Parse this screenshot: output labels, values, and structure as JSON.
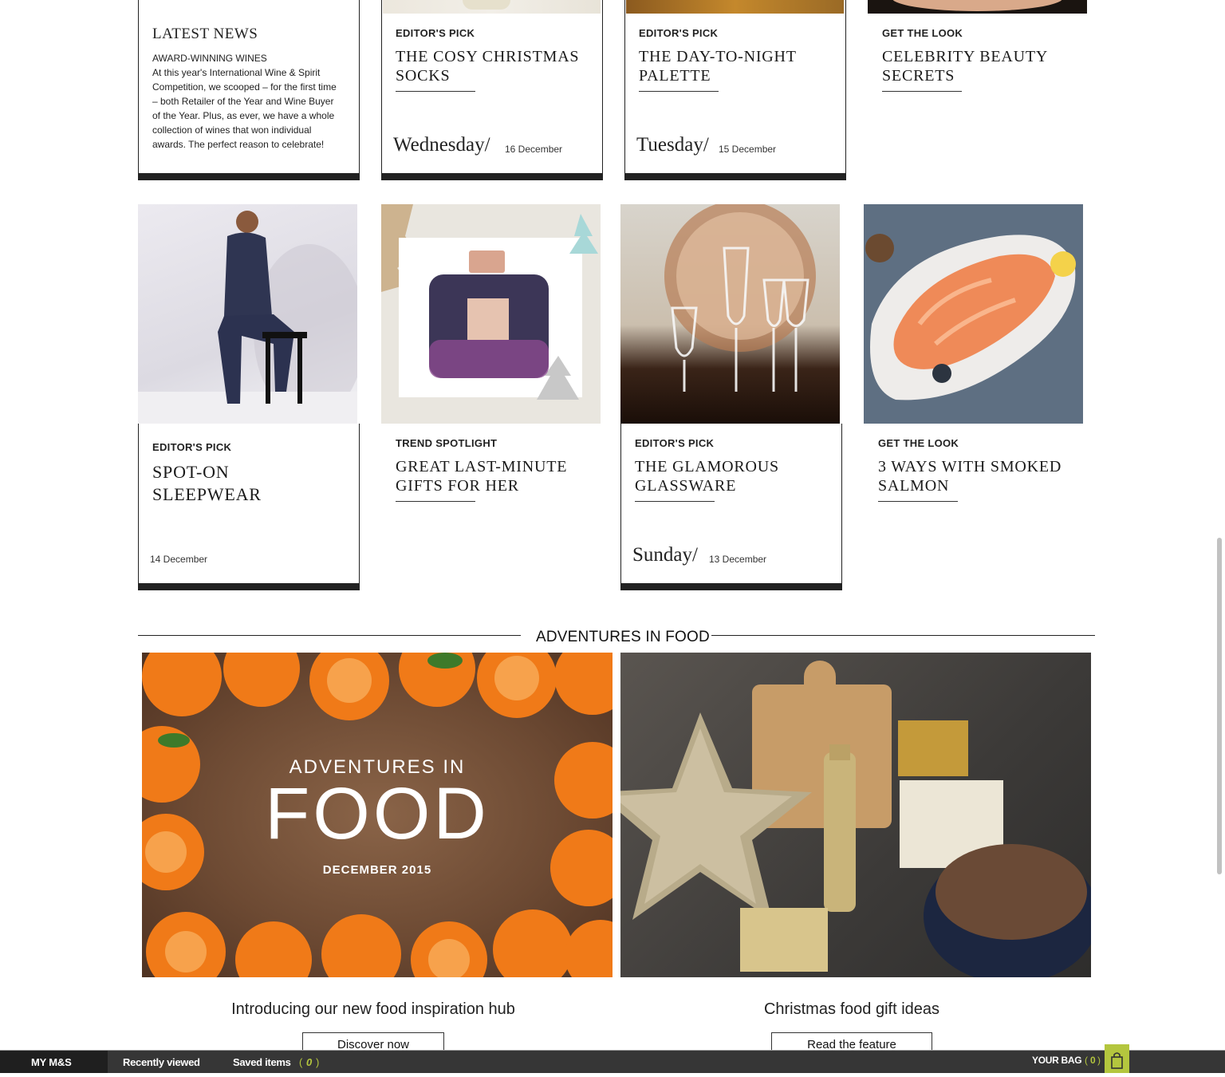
{
  "latest_news": {
    "title": "LATEST NEWS",
    "subtitle": "AWARD-WINNING WINES",
    "body": "At this year's International Wine & Spirit Competition, we scooped – for the first time – both Retailer of the Year and Wine Buyer of the Year. Plus, as ever, we have a whole collection of wines that won individual awards. The perfect reason to celebrate!"
  },
  "row1": [
    {
      "kicker": "EDITOR'S PICK",
      "title": "THE COSY CHRISTMAS SOCKS",
      "day": "Wednesday/",
      "date": "16 December"
    },
    {
      "kicker": "EDITOR'S PICK",
      "title": "THE DAY-TO-NIGHT PALETTE",
      "day": "Tuesday/",
      "date": "15 December"
    },
    {
      "kicker": "GET THE LOOK",
      "title": "CELEBRITY BEAUTY SECRETS"
    }
  ],
  "row2": [
    {
      "kicker": "EDITOR'S PICK",
      "title": "SPOT-ON SLEEPWEAR",
      "date": "14 December"
    },
    {
      "kicker": "TREND SPOTLIGHT",
      "title": "GREAT LAST-MINUTE GIFTS FOR HER"
    },
    {
      "kicker": "EDITOR'S PICK",
      "title": "THE GLAMOROUS GLASSWARE",
      "day": "Sunday/",
      "date": "13 December"
    },
    {
      "kicker": "GET THE LOOK",
      "title": "3 WAYS WITH SMOKED SALMON"
    }
  ],
  "food_section": {
    "heading": "ADVENTURES IN FOOD",
    "banner_line1": "ADVENTURES IN",
    "banner_line2": "FOOD",
    "banner_line3": "DECEMBER 2015",
    "promo_left": {
      "text": "Introducing our new food inspiration hub",
      "button": "Discover now"
    },
    "promo_right": {
      "text": "Christmas food gift ideas",
      "button": "Read the feature"
    }
  },
  "footer": {
    "my_ms": "MY M&S",
    "recently_viewed": "Recently viewed",
    "saved_items": "Saved items",
    "saved_count": "0",
    "your_bag": "YOUR BAG",
    "bag_count": "0"
  },
  "colors": {
    "accent_green": "#b4c63e",
    "footer_bg": "#363636",
    "bar_dark": "#222222"
  }
}
